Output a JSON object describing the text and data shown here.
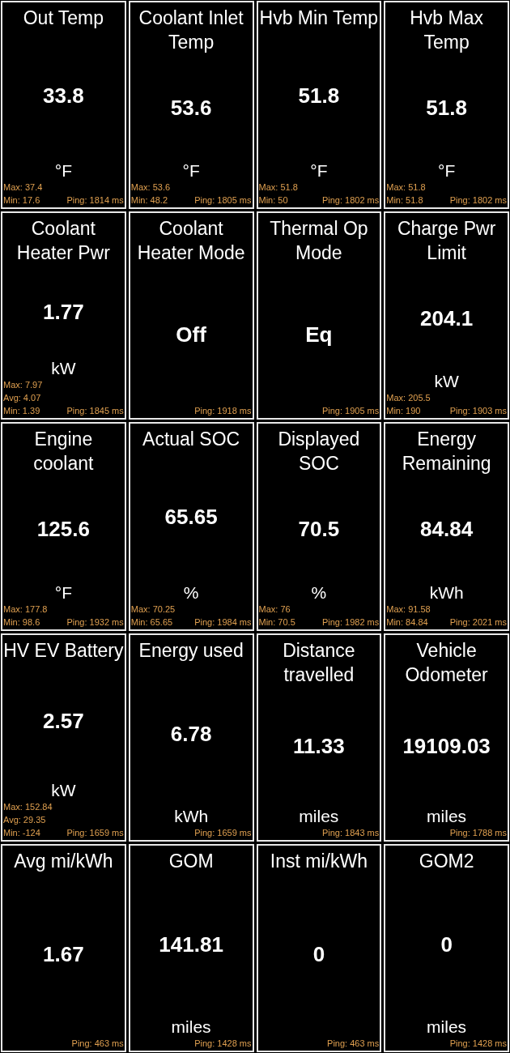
{
  "tiles": [
    {
      "title": "Out Temp",
      "value": "33.8",
      "unit": "°F",
      "stats": [
        "Max: 37.4",
        "Min: 17.6"
      ],
      "ping": "Ping: 1814 ms"
    },
    {
      "title": "Coolant Inlet Temp",
      "value": "53.6",
      "unit": "°F",
      "stats": [
        "Max: 53.6",
        "Min: 48.2"
      ],
      "ping": "Ping: 1805 ms"
    },
    {
      "title": "Hvb Min Temp",
      "value": "51.8",
      "unit": "°F",
      "stats": [
        "Max: 51.8",
        "Min: 50"
      ],
      "ping": "Ping: 1802 ms"
    },
    {
      "title": "Hvb Max Temp",
      "value": "51.8",
      "unit": "°F",
      "stats": [
        "Max: 51.8",
        "Min: 51.8"
      ],
      "ping": "Ping: 1802 ms"
    },
    {
      "title": "Coolant Heater Pwr",
      "value": "1.77",
      "unit": "kW",
      "stats": [
        "Max: 7.97",
        "Avg: 4.07",
        "Min: 1.39"
      ],
      "ping": "Ping: 1845 ms"
    },
    {
      "title": "Coolant Heater Mode",
      "value": "Off",
      "ping": "Ping: 1918 ms"
    },
    {
      "title": "Thermal Op Mode",
      "value": "Eq",
      "ping": "Ping: 1905 ms"
    },
    {
      "title": "Charge Pwr Limit",
      "value": "204.1",
      "unit": "kW",
      "stats": [
        "Max: 205.5",
        "Min: 190"
      ],
      "ping": "Ping: 1903 ms"
    },
    {
      "title": "Engine coolant",
      "value": "125.6",
      "unit": "°F",
      "stats": [
        "Max: 177.8",
        "Min: 98.6"
      ],
      "ping": "Ping: 1932 ms"
    },
    {
      "title": "Actual SOC",
      "value": "65.65",
      "unit": "%",
      "stats": [
        "Max: 70.25",
        "Min: 65.65"
      ],
      "ping": "Ping: 1984 ms"
    },
    {
      "title": "Displayed SOC",
      "value": "70.5",
      "unit": "%",
      "stats": [
        "Max: 76",
        "Min: 70.5"
      ],
      "ping": "Ping: 1982 ms"
    },
    {
      "title": "Energy Remaining",
      "value": "84.84",
      "unit": "kWh",
      "stats": [
        "Max: 91.58",
        "Min: 84.84"
      ],
      "ping": "Ping: 2021 ms"
    },
    {
      "title": "HV EV Battery",
      "value": "2.57",
      "unit": "kW",
      "stats": [
        "Max: 152.84",
        "Avg: 29.35",
        "Min: -124"
      ],
      "ping": "Ping: 1659 ms"
    },
    {
      "title": "Energy used",
      "value": "6.78",
      "unit": "kWh",
      "ping": "Ping: 1659 ms"
    },
    {
      "title": "Distance travelled",
      "value": "11.33",
      "unit": "miles",
      "ping": "Ping: 1843 ms"
    },
    {
      "title": "Vehicle Odometer",
      "value": "19109.03",
      "unit": "miles",
      "ping": "Ping: 1788 ms"
    },
    {
      "title": "Avg mi/kWh",
      "value": "1.67",
      "ping": "Ping: 463 ms"
    },
    {
      "title": "GOM",
      "value": "141.81",
      "unit": "miles",
      "ping": "Ping: 1428 ms"
    },
    {
      "title": "Inst mi/kWh",
      "value": "0",
      "ping": "Ping: 463 ms"
    },
    {
      "title": "GOM2",
      "value": "0",
      "unit": "miles",
      "ping": "Ping: 1428 ms"
    }
  ]
}
